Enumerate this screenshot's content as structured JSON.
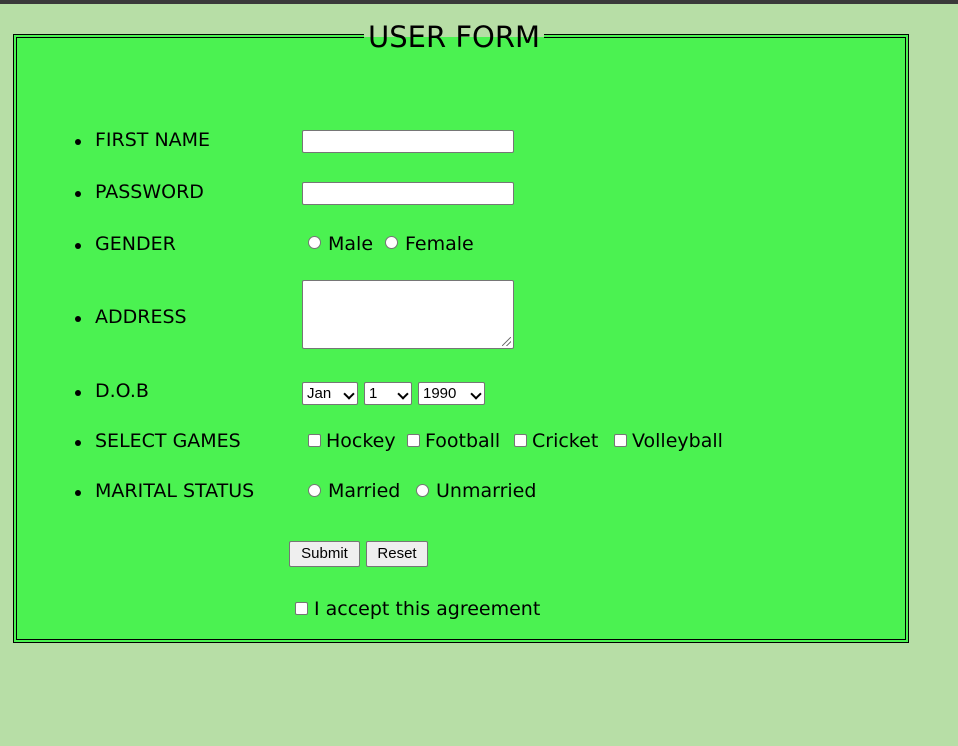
{
  "form": {
    "title": "USER FORM",
    "fields": {
      "first_name": {
        "label": "FIRST NAME",
        "value": ""
      },
      "password": {
        "label": "PASSWORD",
        "value": ""
      },
      "gender": {
        "label": "GENDER",
        "options": [
          "Male",
          "Female"
        ],
        "selected": null
      },
      "address": {
        "label": "ADDRESS",
        "value": ""
      },
      "dob": {
        "label": "D.O.B",
        "month": "Jan",
        "day": "1",
        "year": "1990"
      },
      "games": {
        "label": "SELECT GAMES",
        "options": [
          "Hockey",
          "Football",
          "Cricket",
          "Volleyball"
        ],
        "checked": []
      },
      "marital": {
        "label": "MARITAL STATUS",
        "options": [
          "Married",
          "Unmarried"
        ],
        "selected": null
      }
    },
    "buttons": {
      "submit": "Submit",
      "reset": "Reset"
    },
    "agreement": {
      "label": "I accept this agreement",
      "checked": false
    }
  },
  "colors": {
    "page_bg": "#b7dea6",
    "form_bg": "#4bf251",
    "top_bar": "#3a3a3a"
  },
  "icons": {
    "bullet": "disc",
    "resize": "textarea-resize-grip",
    "dropdown": "chevron-down-icon"
  }
}
